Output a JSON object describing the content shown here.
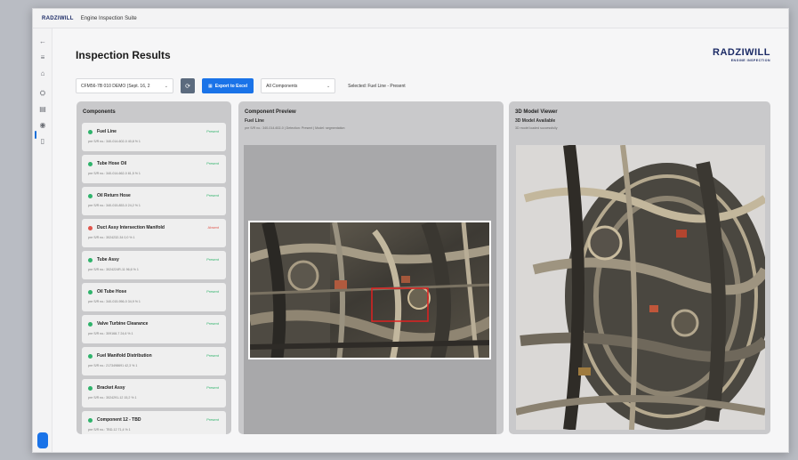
{
  "app": {
    "logo": "RADZIWILL",
    "title": "Engine Inspection Suite"
  },
  "page": {
    "title": "Inspection Results"
  },
  "brand": {
    "name": "RADZIWILL",
    "subtitle": "ENGINE INSPECTION"
  },
  "toolbar": {
    "engine_select": "CFM56-7B 010 DEMO (Sept. 16, 2",
    "refresh_icon": "refresh-icon",
    "export_label": "Export to Excel",
    "filter_select": "All Components",
    "selected_label": "Selected: Fuel Line - Present"
  },
  "components_panel": {
    "header": "Components",
    "items": [
      {
        "name": "Fuel Line",
        "status": "Present",
        "meta": "pre S/R no.: 340-014-602-0    40,8 %    1"
      },
      {
        "name": "Tube Hose Oil",
        "status": "Present",
        "meta": "pre S/R no.: 340-014-662-0    81,5 %    1"
      },
      {
        "name": "Oil Return Hose",
        "status": "Present",
        "meta": "pre S/R no.: 340-015-853-0    24,2 %    1"
      },
      {
        "name": "Duct Assy Intersection Manifold",
        "status": "Absent",
        "meta": "pre S/R no.: 3024232-34    0,0 %    1"
      },
      {
        "name": "Tube Assy",
        "status": "Present",
        "meta": "pre S/R no.: 3024224R-11    96,6 %    1"
      },
      {
        "name": "Oil Tube Hose",
        "status": "Present",
        "meta": "pre S/R no.: 340-015-956-0    34,9 %    1"
      },
      {
        "name": "Valve Turbine Clearance",
        "status": "Present",
        "meta": "pre S/R no.: 309168-7    24,6 %    1"
      },
      {
        "name": "Fuel Manifold Distribution",
        "status": "Present",
        "meta": "pre S/R no.: 2173498691    42,3 %    1"
      },
      {
        "name": "Bracket Assy",
        "status": "Present",
        "meta": "pre S/R no.: 3024291-12    15,2 %    1"
      },
      {
        "name": "Component 12 - TBD",
        "status": "Present",
        "meta": "pre S/R no.: TBD-12    71,4 %    1"
      }
    ]
  },
  "preview_panel": {
    "header": "Component Preview",
    "component": "Fuel Line",
    "meta": "pre S/R no.: 340-014-602-0 | Detection: Present | Model: segmentation"
  },
  "viewer_panel": {
    "header": "3D Model Viewer",
    "status": "3D Model Available",
    "message": "3D model loaded successfully"
  },
  "colors": {
    "accent": "#1a73e8",
    "present": "#2fb36b",
    "absent": "#e0554c",
    "brand": "#1c2b66"
  }
}
